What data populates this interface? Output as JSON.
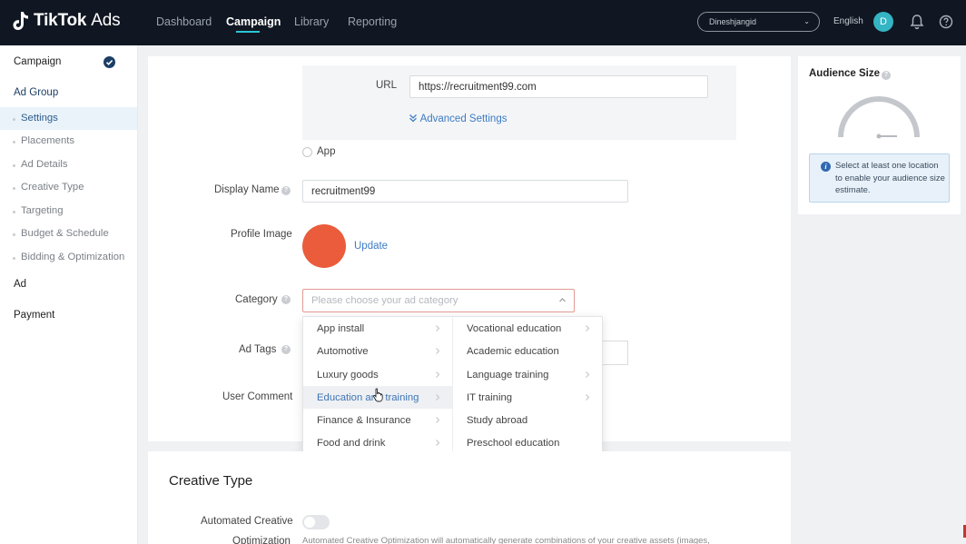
{
  "app": {
    "brand": "TikTok",
    "brand_suffix": "Ads"
  },
  "topnav": {
    "items": [
      {
        "label": "Dashboard",
        "active": false
      },
      {
        "label": "Campaign",
        "active": true
      },
      {
        "label": "Library",
        "active": false
      },
      {
        "label": "Reporting",
        "active": false
      }
    ],
    "account": "Dineshjangid",
    "language": "English",
    "avatar_letter": "D"
  },
  "sidebar": {
    "campaign": "Campaign",
    "ad_group": "Ad Group",
    "sub_items": [
      {
        "label": "Settings",
        "active": true
      },
      {
        "label": "Placements",
        "active": false
      },
      {
        "label": "Ad Details",
        "active": false
      },
      {
        "label": "Creative Type",
        "active": false
      },
      {
        "label": "Targeting",
        "active": false
      },
      {
        "label": "Budget & Schedule",
        "active": false
      },
      {
        "label": "Bidding & Optimization",
        "active": false
      }
    ],
    "ad": "Ad",
    "payment": "Payment"
  },
  "form": {
    "url_label": "URL",
    "url_value": "https://recruitment99.com",
    "advanced_settings": "Advanced Settings",
    "app_option": "App",
    "display_name_label": "Display Name",
    "display_name_value": "recruitment99",
    "profile_image_label": "Profile Image",
    "update_link": "Update",
    "category_label": "Category",
    "category_placeholder": "Please choose your ad category",
    "ad_tags_label": "Ad Tags",
    "user_comment_label": "User Comment"
  },
  "category_dropdown": {
    "left": [
      {
        "label": "App install",
        "has_children": true
      },
      {
        "label": "Automotive",
        "has_children": true
      },
      {
        "label": "Luxury goods",
        "has_children": true
      },
      {
        "label": "Education and training",
        "has_children": true,
        "hover": true
      },
      {
        "label": "Finance & Insurance",
        "has_children": true
      },
      {
        "label": "Food and drink",
        "has_children": true
      }
    ],
    "right": [
      {
        "label": "Vocational education",
        "has_children": true
      },
      {
        "label": "Academic education",
        "has_children": false
      },
      {
        "label": "Language training",
        "has_children": true
      },
      {
        "label": "IT training",
        "has_children": true
      },
      {
        "label": "Study abroad",
        "has_children": false
      },
      {
        "label": "Preschool education",
        "has_children": false
      }
    ]
  },
  "creative": {
    "title": "Creative Type",
    "automated_label_1": "Automated Creative",
    "automated_label_2": "Optimization",
    "help_text": "Automated Creative Optimization will automatically generate combinations of your creative assets (images,"
  },
  "audience": {
    "title": "Audience Size",
    "info": "Select at least one location to enable your audience size estimate."
  },
  "colors": {
    "topbar": "#101722",
    "accent": "#2bc6d4",
    "link": "#3c7bc4",
    "category_border": "#e39a94",
    "profile": "#ea5c3b"
  }
}
